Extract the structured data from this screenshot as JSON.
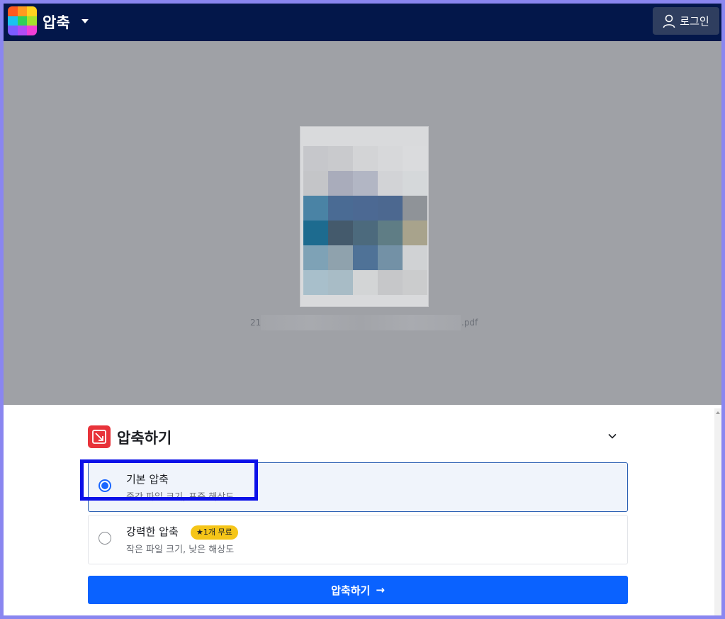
{
  "header": {
    "app_title": "압축",
    "login_label": "로그인",
    "logo_colors": [
      "#ff5a1f",
      "#ff9a1f",
      "#ffd21f",
      "#19c3f0",
      "#2fd15a",
      "#a4e22d",
      "#7b5cff",
      "#b04cf5",
      "#f13fd6"
    ]
  },
  "preview": {
    "filename_start": "21",
    "filename_end": ".pdf",
    "mosaic_colors": [
      "#c6c7cb",
      "#c9cacd",
      "#d3d4d6",
      "#d7d8da",
      "#dadbdd",
      "#c4c5c8",
      "#a9acbb",
      "#b2b6c4",
      "#d2d3d6",
      "#d5d8da",
      "#4a83a5",
      "#4a6b94",
      "#4c6993",
      "#4c6890",
      "#8f9398",
      "#1d6b8f",
      "#445a6c",
      "#4c6a7d",
      "#5f7d85",
      "#a8a38c",
      "#7ea2b6",
      "#8fa2ad",
      "#4f7297",
      "#7391a6",
      "#d0d2d4",
      "#a8bfcb",
      "#a8bcc6",
      "#d3d5d6",
      "#c6c7c9",
      "#cbcccd"
    ]
  },
  "panel": {
    "title": "압축하기",
    "options": [
      {
        "title": "기본 압축",
        "desc": "중간 파일 크기, 표준 해상도",
        "selected": true
      },
      {
        "title": "강력한 압축",
        "desc": "작은 파일 크기, 낮은 해상도",
        "badge": "★1개 무료",
        "selected": false
      }
    ],
    "action_label": "압축하기",
    "action_arrow": "→"
  },
  "colors": {
    "topbar": "#03174a",
    "accent": "#0a62ff",
    "badge": "#f5c518",
    "highlight": "#0c11e8"
  }
}
